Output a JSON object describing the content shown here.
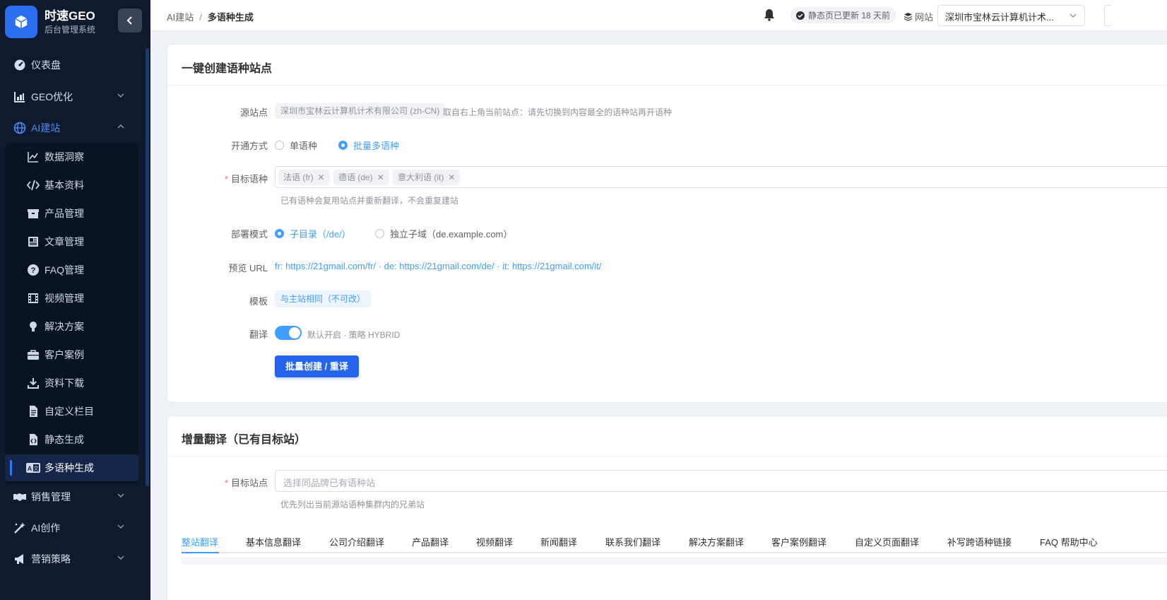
{
  "brand": {
    "title": "时速GEO",
    "subtitle": "后台管理系统"
  },
  "sidebar": {
    "top_items": [
      {
        "label": "仪表盘",
        "icon": "dashboard-icon"
      },
      {
        "label": "GEO优化",
        "icon": "chart-bar-icon"
      },
      {
        "label": "AI建站",
        "icon": "globe-icon"
      }
    ],
    "sub_items": [
      {
        "label": "数据洞察",
        "icon": "line-chart-icon"
      },
      {
        "label": "基本资料",
        "icon": "code-icon"
      },
      {
        "label": "产品管理",
        "icon": "box-icon"
      },
      {
        "label": "文章管理",
        "icon": "newspaper-icon"
      },
      {
        "label": "FAQ管理",
        "icon": "question-icon"
      },
      {
        "label": "视频管理",
        "icon": "film-icon"
      },
      {
        "label": "解决方案",
        "icon": "lightbulb-icon"
      },
      {
        "label": "客户案例",
        "icon": "briefcase-icon"
      },
      {
        "label": "资料下载",
        "icon": "download-icon"
      },
      {
        "label": "自定义栏目",
        "icon": "file-icon"
      },
      {
        "label": "静态生成",
        "icon": "file-code-icon"
      },
      {
        "label": "多语种生成",
        "icon": "translate-icon"
      }
    ],
    "bottom_items": [
      {
        "label": "销售管理",
        "icon": "handshake-icon"
      },
      {
        "label": "AI创作",
        "icon": "magic-icon"
      },
      {
        "label": "营销策略",
        "icon": "megaphone-icon"
      }
    ]
  },
  "header": {
    "breadcrumb_parent": "AI建站",
    "breadcrumb_sep": "/",
    "breadcrumb_current": "多语种生成",
    "status_text": "静态页已更新 18 天前",
    "site_label": "网站",
    "site_select_value": "深圳市宝林云计算机计术..."
  },
  "create_card": {
    "title": "一键创建语种站点",
    "source_label": "源站点",
    "source_value": "深圳市宝林云计算机计术有限公司 (zh-CN)",
    "source_hint": "取自右上角当前站点：请先切换到内容最全的语种站再开语种",
    "mode_label": "开通方式",
    "mode_options": [
      "单语种",
      "批量多语种"
    ],
    "target_label": "目标语种",
    "target_chips": [
      "法语 (fr)",
      "德语 (de)",
      "意大利语 (it)"
    ],
    "target_hint": "已有语种会复用站点并重新翻译，不会重复建站",
    "deploy_label": "部署模式",
    "deploy_options": [
      "子目录（/de/）",
      "独立子域（de.example.com）"
    ],
    "preview_label": "预览 URL",
    "preview_value": "fr: https://21gmail.com/fr/ · de: https://21gmail.com/de/ · it: https://21gmail.com/it/",
    "template_label": "模板",
    "template_value": "与主站相同（不可改）",
    "translate_label": "翻译",
    "translate_hint": "默认开启 · 策略 HYBRID",
    "translate_on": true,
    "submit_label": "批量创建 / 重译"
  },
  "incremental_card": {
    "title": "增量翻译（已有目标站）",
    "target_site_label": "目标站点",
    "target_site_placeholder": "选择同品牌已有语种站",
    "target_site_hint": "优先列出当前源站语种集群内的兄弟站",
    "tabs": [
      "整站翻译",
      "基本信息翻译",
      "公司介绍翻译",
      "产品翻译",
      "视频翻译",
      "新闻翻译",
      "联系我们翻译",
      "解决方案翻译",
      "客户案例翻译",
      "自定义页面翻译",
      "补写跨语种链接",
      "FAQ 帮助中心"
    ],
    "active_tab": 0
  },
  "colors": {
    "accent": "#409eff",
    "primary_button": "#2463eb",
    "sidebar_bg": "#0f1a2e",
    "required": "#f56c6c"
  }
}
